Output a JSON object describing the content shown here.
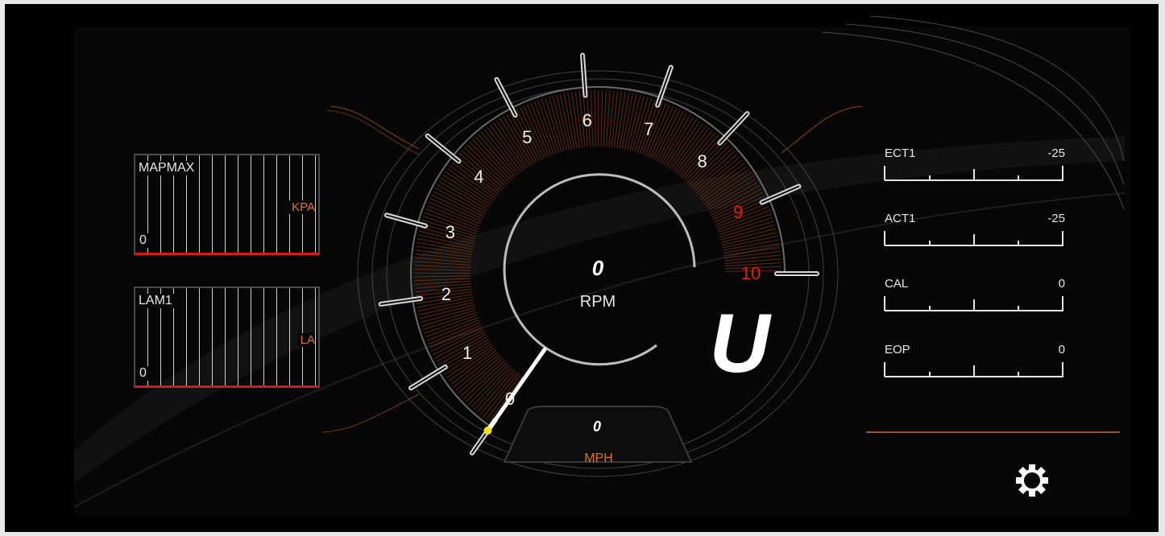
{
  "colors": {
    "accent": "#e0741f",
    "redline": "#e11c1c",
    "text": "#e6e6e6",
    "background": "#000000"
  },
  "tachometer": {
    "ticks": [
      "0",
      "1",
      "2",
      "3",
      "4",
      "5",
      "6",
      "7",
      "8",
      "9",
      "10"
    ],
    "redline_ticks": [
      "9",
      "10"
    ],
    "rpm_value": "0",
    "rpm_label": "RPM",
    "needle_fraction": 0
  },
  "gear": {
    "value": "U"
  },
  "speed": {
    "value": "0",
    "unit": "MPH"
  },
  "bar_gauges": [
    {
      "label": "MAPMAX",
      "unit": "KPA",
      "value": "0"
    },
    {
      "label": "LAM1",
      "unit": "LA",
      "value": "0"
    }
  ],
  "sensors": [
    {
      "label": "ECT1",
      "value": "-25"
    },
    {
      "label": "ACT1",
      "value": "-25"
    },
    {
      "label": "CAL",
      "value": "0"
    },
    {
      "label": "EOP",
      "value": "0"
    }
  ],
  "icons": {
    "settings": "gear-icon"
  }
}
